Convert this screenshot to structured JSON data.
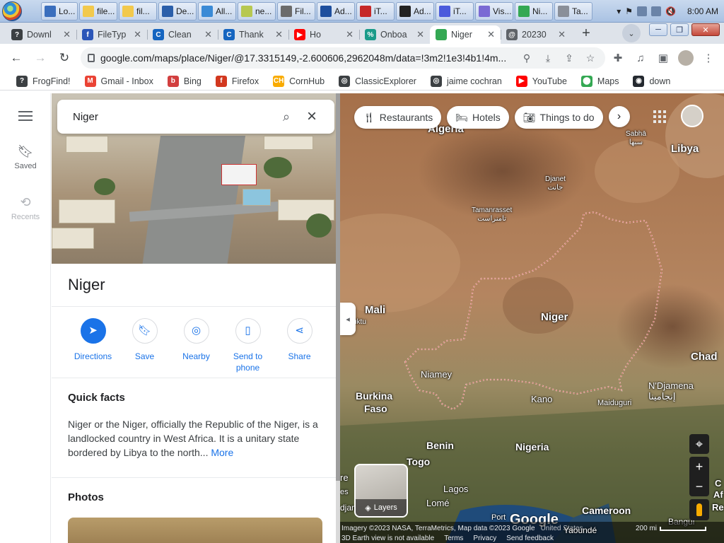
{
  "taskbar": {
    "items": [
      {
        "label": "Lo...",
        "color": "#3a6ebd"
      },
      {
        "label": "file...",
        "color": "#f2c94c"
      },
      {
        "label": "fil...",
        "color": "#f2c94c"
      },
      {
        "label": "De...",
        "color": "#2b5faa"
      },
      {
        "label": "All...",
        "color": "#3a8ad6"
      },
      {
        "label": "ne...",
        "color": "#b7c850"
      },
      {
        "label": "Fil...",
        "color": "#6b6b6b"
      },
      {
        "label": "Ad...",
        "color": "#1e4f9e"
      },
      {
        "label": "iT...",
        "color": "#c62828"
      },
      {
        "label": "Ad...",
        "color": "#222222"
      },
      {
        "label": "iT...",
        "color": "#4b5bdc"
      },
      {
        "label": "Vis...",
        "color": "#7a6ad4"
      },
      {
        "label": "Ni...",
        "color": "#34a853"
      },
      {
        "label": "Ta...",
        "color": "#8a8f99"
      }
    ],
    "clock": "8:00 AM"
  },
  "tabs": [
    {
      "label": "Downl",
      "fav_color": "#3c4043",
      "fav_text": "?"
    },
    {
      "label": "FileTyp",
      "fav_color": "#2b56b8",
      "fav_text": "f"
    },
    {
      "label": "Clean",
      "fav_color": "#1565c0",
      "fav_text": "C"
    },
    {
      "label": "Thank",
      "fav_color": "#1565c0",
      "fav_text": "C"
    },
    {
      "label": "Ho",
      "fav_color": "#ff0000",
      "fav_text": "▶"
    },
    {
      "label": "Onboa",
      "fav_color": "#1a9b8a",
      "fav_text": "%"
    },
    {
      "label": "Niger",
      "fav_color": "#34a853",
      "fav_text": "",
      "active": true
    },
    {
      "label": "20230",
      "fav_color": "#5f6368",
      "fav_text": "@"
    }
  ],
  "address": {
    "url": "google.com/maps/place/Niger/@17.3315149,-2.600606,2962048m/data=!3m2!1e3!4b1!4m..."
  },
  "bookmarks": [
    {
      "label": "FrogFind!",
      "color": "#3c4043",
      "text": "?"
    },
    {
      "label": "Gmail - Inbox",
      "color": "#ea4335",
      "text": "M"
    },
    {
      "label": "Bing",
      "color": "#d23f3f",
      "text": "b"
    },
    {
      "label": "Firefox",
      "color": "#d2381f",
      "text": "f"
    },
    {
      "label": "CornHub",
      "color": "#f9ab00",
      "text": "CH"
    },
    {
      "label": "ClassicExplorer",
      "color": "#3c4043",
      "text": "◎"
    },
    {
      "label": "jaime cochran",
      "color": "#3c4043",
      "text": "◎"
    },
    {
      "label": "YouTube",
      "color": "#ff0000",
      "text": "▶"
    },
    {
      "label": "Maps",
      "color": "#34a853",
      "text": "⬤"
    },
    {
      "label": "down",
      "color": "#24292f",
      "text": "◉"
    }
  ],
  "rail": {
    "saved": "Saved",
    "recents": "Recents"
  },
  "search": {
    "query": "Niger"
  },
  "place": {
    "title": "Niger",
    "actions": [
      {
        "label": "Directions",
        "icon": "directions-icon"
      },
      {
        "label": "Save",
        "icon": "bookmark-icon"
      },
      {
        "label": "Nearby",
        "icon": "nearby-icon"
      },
      {
        "label": "Send to phone",
        "icon": "phone-icon"
      },
      {
        "label": "Share",
        "icon": "share-icon"
      }
    ],
    "quick_facts_title": "Quick facts",
    "quick_facts_text": "Niger or the Niger, officially the Republic of the Niger, is a landlocked country in West Africa. It is a unitary state bordered by Libya to the north...",
    "more_link": "More",
    "photos_title": "Photos"
  },
  "map": {
    "chips": [
      {
        "label": "Restaurants",
        "icon": "restaurant-icon"
      },
      {
        "label": "Hotels",
        "icon": "hotel-icon"
      },
      {
        "label": "Things to do",
        "icon": "camera-icon"
      }
    ],
    "labels": {
      "algeria": "Algeria",
      "libya": "Libya",
      "sabha": "Sabhā",
      "sabha_ar": "سبها",
      "djanet": "Djanet",
      "djanet_ar": "جانت",
      "tamanrasset": "Tamanrasset",
      "tamanrasset_ar": "تامنراست",
      "mali": "Mali",
      "niger": "Niger",
      "chad": "Chad",
      "niamey": "Niamey",
      "burkina": "Burkina",
      "faso": "Faso",
      "kano": "Kano",
      "maiduguri": "Maiduguri",
      "ndjamena": "N'Djamena",
      "ndjamena_ar": "إنجامينا",
      "benin": "Benin",
      "nigeria": "Nigeria",
      "togo": "Togo",
      "lagos": "Lagos",
      "lome": "Lomé",
      "cameroon": "Cameroon",
      "bangui": "Bangui",
      "buktu": "uktu",
      "edge_re": "re",
      "edge_djan": "djan",
      "edge_port": "Port",
      "edge_yaounde": "Yaoundé",
      "edge_c": "C",
      "edge_af": "Af",
      "edge_re2": "Re",
      "edge_es": "es"
    },
    "layers_label": "Layers",
    "google_logo": "Google",
    "attribution": "Imagery ©2023 NASA, TerraMetrics, Map data ©2023 Google",
    "country_link": "United States",
    "earth_note": "3D Earth view is not available",
    "terms": "Terms",
    "privacy": "Privacy",
    "feedback": "Send feedback",
    "scale": "200 mi"
  }
}
